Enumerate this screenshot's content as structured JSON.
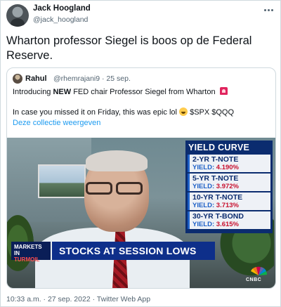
{
  "author": {
    "name": "Jack Hoogland",
    "handle": "@jack_hoogland"
  },
  "tweet_text": "Wharton professor Siegel is boos op de Federal Reserve.",
  "quoted": {
    "name": "Rahul",
    "meta": "@rhemrajani9 · 25 sep.",
    "line1_pre": "Introducing ",
    "line1_bold": "NEW",
    "line1_post": " FED chair Professor Siegel from Wharton",
    "line2_pre": "In case you missed it on Friday, this was epic lol ",
    "line2_post": " $SPX $QQQ",
    "link": "Deze collectie weergeven",
    "emoji_names": [
      "police-siren-emoji",
      "laughing-emoji"
    ]
  },
  "video": {
    "yield_curve_title": "YIELD CURVE",
    "yield_prefix": "YIELD: ",
    "yields": [
      {
        "label": "2-YR T-NOTE",
        "value": "4.190%"
      },
      {
        "label": "5-YR T-NOTE",
        "value": "3.972%"
      },
      {
        "label": "10-YR T-NOTE",
        "value": "3.713%"
      },
      {
        "label": "30-YR T-BOND",
        "value": "3.615%"
      }
    ],
    "markets_tag_1": "MARKETS IN",
    "markets_tag_2": "TURMOIL",
    "banner": "STOCKS AT SESSION LOWS",
    "network": "CNBC"
  },
  "footer_meta": "10:33 a.m. · 27 sep. 2022 · Twitter Web App",
  "colors": {
    "link": "#1d9bf0",
    "secondary_text": "#536471",
    "border": "#cfd9de",
    "cnbc_blue": "#0e2f8a"
  }
}
